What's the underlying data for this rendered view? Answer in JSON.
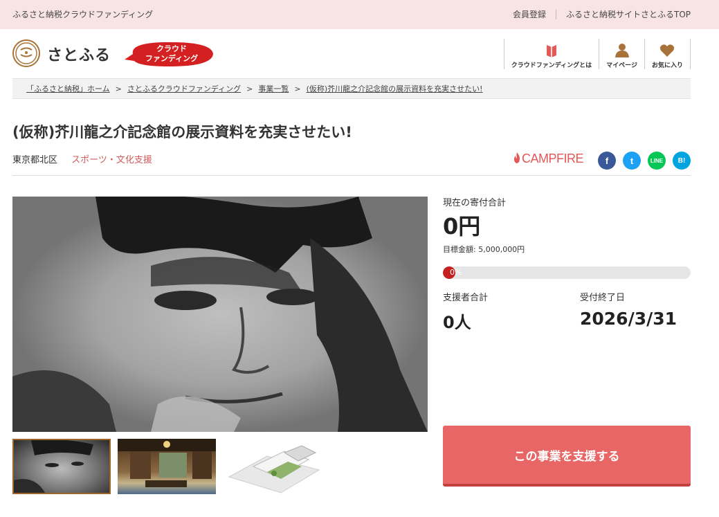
{
  "topbar": {
    "site_name": "ふるさと納税クラウドファンディング",
    "register_link": "会員登録",
    "top_link": "ふるさと納税サイトさとふるTOP"
  },
  "header": {
    "logo_text": "さとふる",
    "logo_mark": "さとふる",
    "badge_line1": "クラウド",
    "badge_line2": "ファンディング",
    "nav": [
      {
        "label": "クラウドファンディングとは",
        "icon": "book-icon"
      },
      {
        "label": "マイページ",
        "icon": "user-icon"
      },
      {
        "label": "お気に入り",
        "icon": "heart-icon"
      }
    ]
  },
  "breadcrumb": [
    "「ふるさと納税」ホーム",
    "さとふるクラウドファンディング",
    "事業一覧",
    "(仮称)芥川龍之介記念館の展示資料を充実させたい!"
  ],
  "breadcrumb_sep": ">",
  "project": {
    "title": "(仮称)芥川龍之介記念館の展示資料を充実させたい!",
    "region": "東京都北区",
    "category": "スポーツ・文化支援",
    "partner": "CAMPFIRE"
  },
  "share": {
    "facebook": "f",
    "twitter": "t",
    "line": "LINE",
    "hatena": "B!"
  },
  "stats": {
    "total_label": "現在の寄付合計",
    "total_value": "0円",
    "goal_text": "目標金額: 5,000,000円",
    "progress_text": "0%",
    "progress_fraction": 0,
    "supporters_label": "支援者合計",
    "supporters_value": "0人",
    "deadline_label": "受付終了日",
    "deadline_value": "2026/3/31"
  },
  "cta": {
    "support_label": "この事業を支援する"
  },
  "colors": {
    "topbar_bg": "#f8e4e4",
    "accent_red": "#e86666",
    "category_red": "#d45a5a",
    "logo_brown": "#a8733a"
  }
}
